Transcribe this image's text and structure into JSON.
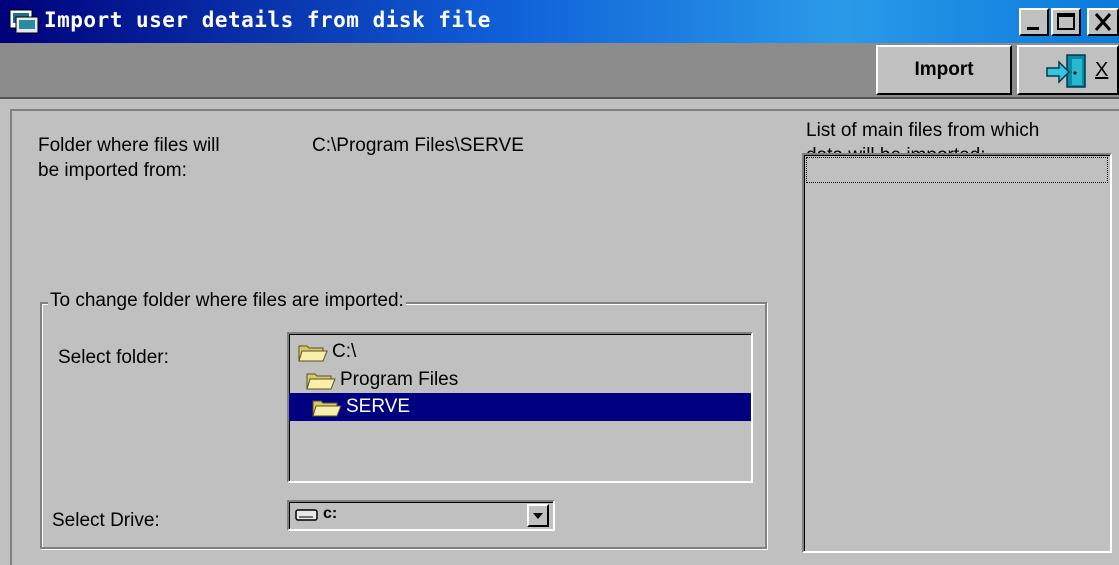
{
  "window": {
    "title": "Import user details from disk file",
    "buttons": {
      "minimize": "_",
      "maximize": "□",
      "close": "X"
    }
  },
  "toolbar": {
    "import_label": "Import",
    "exit_label": "X"
  },
  "main": {
    "folder_label": "Folder where files will\nbe imported from:",
    "folder_path": "C:\\Program Files\\SERVE",
    "files_list_label": "List of main files from which\ndata will be imported:",
    "files": []
  },
  "change_group": {
    "legend": "To change folder where files are imported:",
    "select_folder_label": "Select folder:",
    "folders": [
      {
        "name": "C:\\",
        "selected": false
      },
      {
        "name": "Program Files",
        "selected": false
      },
      {
        "name": "SERVE",
        "selected": true
      }
    ],
    "select_drive_label": "Select Drive:",
    "drive_value": "c:"
  },
  "colors": {
    "title_bar_start": "#00007b",
    "title_bar_end": "#2a9ae8",
    "selection": "#000080",
    "face": "#c0c0c0"
  },
  "icons": [
    "app-icon",
    "minimize-icon",
    "maximize-icon",
    "close-icon",
    "exit-door-icon",
    "folder-open-icon",
    "drive-icon",
    "dropdown-arrow-icon"
  ]
}
